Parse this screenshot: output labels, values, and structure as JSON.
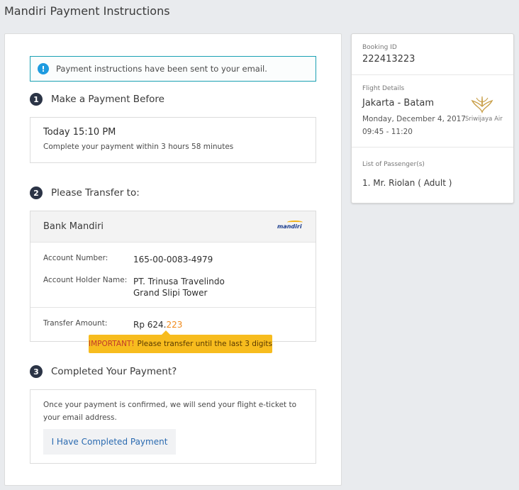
{
  "page": {
    "title": "Mandiri Payment Instructions"
  },
  "alert": {
    "icon": "info-icon",
    "text": "Payment instructions have been sent to your email."
  },
  "step1": {
    "number": "1",
    "title": "Make a Payment Before",
    "deadline": "Today 15:10 PM",
    "note": "Complete your payment within 3 hours 58 minutes"
  },
  "step2": {
    "number": "2",
    "title": "Please Transfer to:",
    "bank_name": "Bank Mandiri",
    "bank_logo_text": "mandiri",
    "account_number_label": "Account Number:",
    "account_number": "165-00-0083-4979",
    "holder_label": "Account Holder Name:",
    "holder_line1": "PT. Trinusa Travelindo",
    "holder_line2": "Grand Slipi Tower",
    "amount_label": "Transfer Amount:",
    "amount_prefix": "Rp 624.",
    "amount_suffix": "223",
    "tooltip_important": "IMPORTANT!",
    "tooltip_text": "Please transfer until the last 3 digits"
  },
  "step3": {
    "number": "3",
    "title": "Completed Your Payment?",
    "text": "Once your payment is confirmed, we will send your flight e-ticket to your email address.",
    "button": "I Have Completed Payment"
  },
  "sidebar": {
    "booking_label": "Booking ID",
    "booking_id": "222413223",
    "flight_label": "Flight Details",
    "route": "Jakarta - Batam",
    "date": "Monday, December 4, 2017",
    "time": "09:45 - 11:20",
    "airline": "Sriwijaya Air",
    "passenger_label": "List of Passenger(s)",
    "passengers": [
      "1. Mr. Riolan ( Adult )"
    ]
  },
  "colors": {
    "accent_teal": "#1ba0b3",
    "info_blue": "#1e9be0",
    "step_dark": "#2b3446",
    "warning": "#f7bc1e",
    "amount_orange": "#f08a1c",
    "link_blue": "#2a6ab0"
  }
}
